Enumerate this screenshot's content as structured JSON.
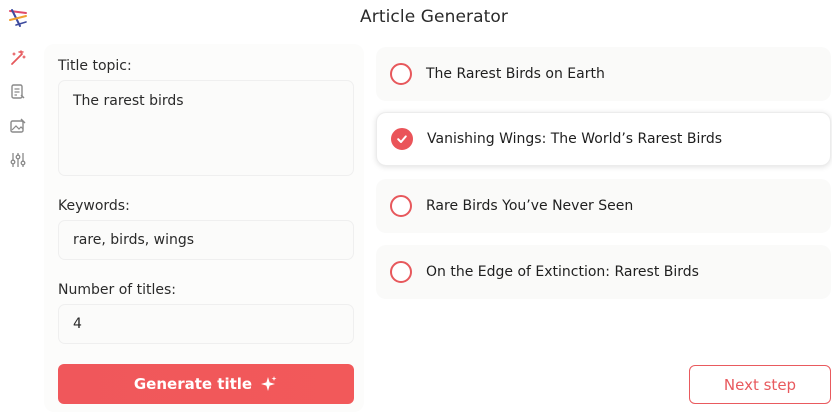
{
  "app": {
    "title": "Article Generator"
  },
  "rail": {
    "icons": [
      "logo-icon",
      "magic-wand-icon",
      "document-edit-icon",
      "image-edit-icon",
      "sliders-icon"
    ]
  },
  "form": {
    "topic_label": "Title topic:",
    "topic_value": "The rarest birds",
    "keywords_label": "Keywords:",
    "keywords_value": "rare, birds, wings",
    "count_label": "Number of titles:",
    "count_value": "4",
    "generate_label": "Generate title"
  },
  "titles": [
    {
      "label": "The Rarest Birds on Earth",
      "selected": false
    },
    {
      "label": "Vanishing Wings: The World’s Rarest Birds",
      "selected": true
    },
    {
      "label": "Rare Birds You’ve Never Seen",
      "selected": false
    },
    {
      "label": "On the Edge of Extinction: Rarest Birds",
      "selected": false
    }
  ],
  "actions": {
    "next_label": "Next step"
  },
  "colors": {
    "accent": "#EA5459",
    "text": "#1F1F1F",
    "panel": "#FAFAF9"
  }
}
